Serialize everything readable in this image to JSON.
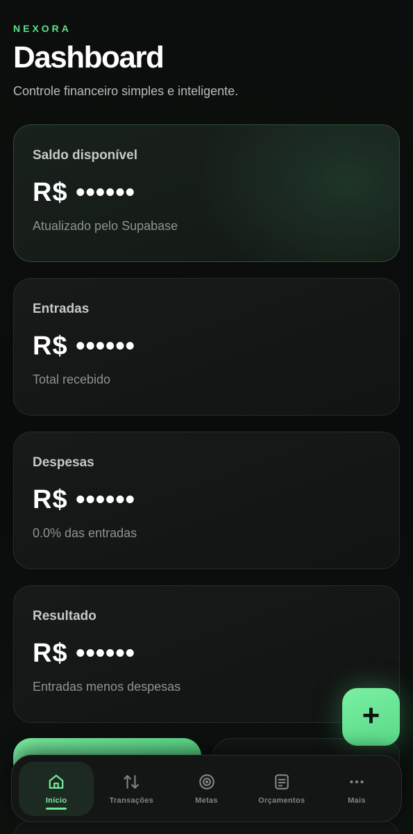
{
  "header": {
    "brand": "NEXORA",
    "title": "Dashboard",
    "subtitle": "Controle financeiro simples e inteligente."
  },
  "cards": [
    {
      "label": "Saldo disponível",
      "value": "R$ ••••••",
      "note": "Atualizado pelo Supabase"
    },
    {
      "label": "Entradas",
      "value": "R$ ••••••",
      "note": "Total recebido"
    },
    {
      "label": "Despesas",
      "value": "R$ ••••••",
      "note": "0.0% das entradas"
    },
    {
      "label": "Resultado",
      "value": "R$ ••••••",
      "note": "Entradas menos despesas"
    }
  ],
  "fab": {
    "label": "+",
    "icon": "plus-icon"
  },
  "tabbar": {
    "items": [
      {
        "label": "Início",
        "icon": "home-icon",
        "active": true
      },
      {
        "label": "Transações",
        "icon": "arrows-up-down-icon",
        "active": false
      },
      {
        "label": "Metas",
        "icon": "target-icon",
        "active": false
      },
      {
        "label": "Orçamentos",
        "icon": "document-icon",
        "active": false
      },
      {
        "label": "Mais",
        "icon": "more-icon",
        "active": false
      }
    ]
  },
  "colors": {
    "accent": "#5fe28d",
    "background": "#0b0d0c",
    "card": "#141715"
  }
}
